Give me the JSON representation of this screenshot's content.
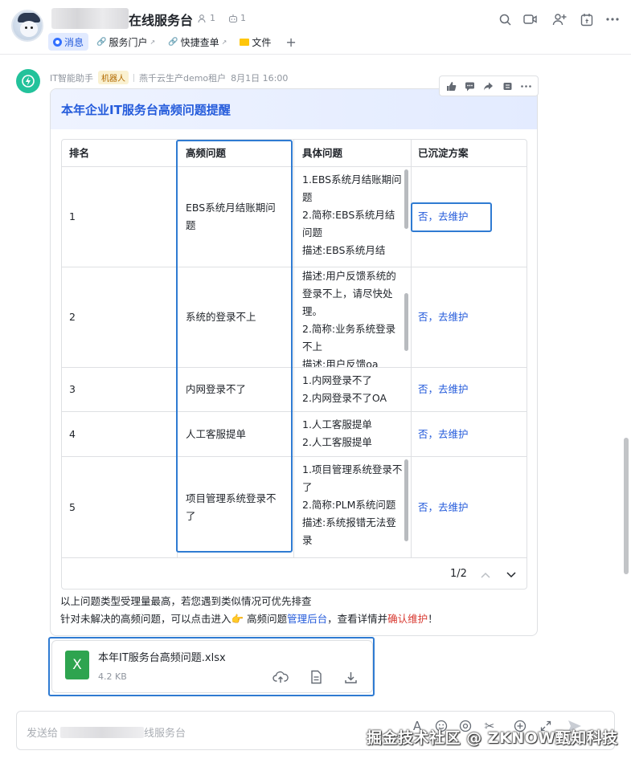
{
  "header": {
    "chat_title": "在线服务台",
    "member_count": "1",
    "bot_count": "1"
  },
  "tabs": [
    {
      "label": "消息"
    },
    {
      "label": "服务门户"
    },
    {
      "label": "快捷查单"
    },
    {
      "label": "文件"
    }
  ],
  "message": {
    "sender": "IT智能助手",
    "robot_tag": "机器人",
    "tenant": "燕千云生产demo租户",
    "time": "8月1日 16:00",
    "card_title": "本年企业IT服务台高频问题提醒",
    "table": {
      "columns": [
        "排名",
        "高频问题",
        "具体问题",
        "已沉淀方案"
      ],
      "rows": [
        {
          "rank": "1",
          "issue": "EBS系统月结账期问题",
          "details": [
            "1.EBS系统月结账期问题",
            "2.简称:EBS系统月结问题",
            "描述:EBS系统月结"
          ],
          "solution": "否，去维护"
        },
        {
          "rank": "2",
          "issue": "系统的登录不上",
          "details": [
            "描述:用户反馈系统的登录不上，请尽快处理。",
            "2.简称:业务系统登录不上",
            "描述:用户反馈oa"
          ],
          "solution": "否，去维护"
        },
        {
          "rank": "3",
          "issue": "内网登录不了",
          "details": [
            "1.内网登录不了",
            "2.内网登录不了OA"
          ],
          "solution": "否，去维护"
        },
        {
          "rank": "4",
          "issue": "人工客服提单",
          "details": [
            "1.人工客服提单",
            "2.人工客服提单"
          ],
          "solution": "否，去维护"
        },
        {
          "rank": "5",
          "issue": "项目管理系统登录不了",
          "details": [
            "1.项目管理系统登录不了",
            "2.简称:PLM系统问题",
            "描述:系统报错无法登录"
          ],
          "solution": "否，去维护"
        }
      ],
      "pager": "1/2"
    },
    "note_line1": "以上问题类型受理量最高，若您遇到类似情况可优先排查",
    "note_line2_prefix": "针对未解决的高频问题，可以点击进入",
    "note_pointer": "👉",
    "note_line2_mid": " 高频问题",
    "note_link": "管理后台",
    "note_line2_mid2": "，查看详情并",
    "note_red": "确认维护",
    "note_line2_suffix": "！"
  },
  "file": {
    "icon_letter": "X",
    "name": "本年IT服务台高频问题.xlsx",
    "size": "4.2 KB"
  },
  "composer": {
    "placeholder_prefix": "发送给",
    "placeholder_suffix": "线服务台"
  },
  "watermark": "掘金技术社区 @ ZKNOW甄知科技",
  "colors": {
    "accent": "#245bdb",
    "highlight_border": "#2f7bd2",
    "file_green": "#2ea44f",
    "bot_green": "#23c29b",
    "warning_red": "#d83931"
  }
}
